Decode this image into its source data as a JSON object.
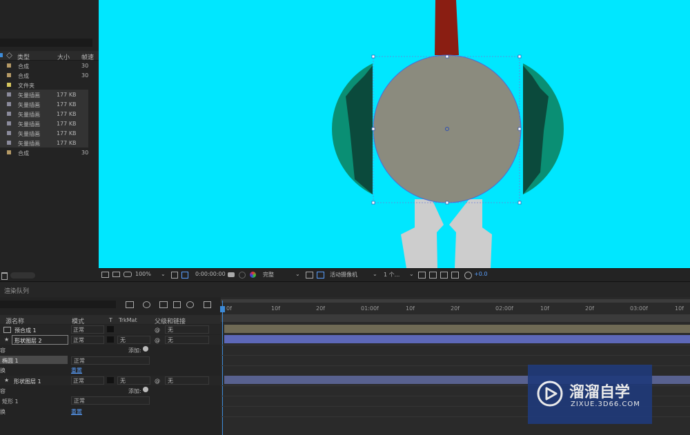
{
  "project_panel": {
    "columns": {
      "type": "类型",
      "size": "大小",
      "fps": "帧速"
    },
    "items": [
      {
        "type": "合成",
        "size": "",
        "fps": "30",
        "color": "#b59a66",
        "highlight": false
      },
      {
        "type": "合成",
        "size": "",
        "fps": "30",
        "color": "#b59a66",
        "highlight": false
      },
      {
        "type": "文件夹",
        "size": "",
        "fps": "",
        "color": "#d6c65e",
        "highlight": false
      },
      {
        "type": "矢量插画",
        "size": "177 KB",
        "fps": "",
        "color": "#8b8b9c",
        "highlight": true
      },
      {
        "type": "矢量插画",
        "size": "177 KB",
        "fps": "",
        "color": "#8b8b9c",
        "highlight": true
      },
      {
        "type": "矢量插画",
        "size": "177 KB",
        "fps": "",
        "color": "#8b8b9c",
        "highlight": true
      },
      {
        "type": "矢量插画",
        "size": "177 KB",
        "fps": "",
        "color": "#8b8b9c",
        "highlight": true
      },
      {
        "type": "矢量插画",
        "size": "177 KB",
        "fps": "",
        "color": "#8b8b9c",
        "highlight": true
      },
      {
        "type": "矢量插画",
        "size": "177 KB",
        "fps": "",
        "color": "#8b8b9c",
        "highlight": true
      },
      {
        "type": "合成",
        "size": "",
        "fps": "30",
        "color": "#b59a66",
        "highlight": false
      }
    ]
  },
  "viewer": {
    "background": "#00e7ff",
    "shape_colors": {
      "circle": "#8b8b7e",
      "teal": "#0a8f74",
      "dark": "#0b4a3c",
      "red": "#8a1e12",
      "legs": "#cdcdcd"
    },
    "toolbar": {
      "zoom": "100%",
      "timecode": "0:00:00:00",
      "resolution": "完整",
      "camera": "活动摄像机",
      "views": "1 个...",
      "exposure": "+0.0"
    }
  },
  "timeline": {
    "tab_label": "渲染队列",
    "headers": {
      "source_name": "源名称",
      "mode": "模式",
      "t": "T",
      "trkmat": "TrkMat",
      "parent": "父级和链接"
    },
    "layers": [
      {
        "name": "预合成 1",
        "mode": "正常",
        "trkmat": "",
        "parent": "无",
        "bar_color": "#6f6a55"
      },
      {
        "name": "形状图层 2",
        "mode": "正常",
        "trkmat": "无",
        "parent": "无",
        "bar_color": "#5d68b8"
      },
      {
        "name": "形状图层 1",
        "mode": "正常",
        "trkmat": "无",
        "parent": "无",
        "bar_color": "#58618f"
      }
    ],
    "sub_rows": {
      "add_label": "添加:",
      "path1": "椭圆 1",
      "rect1": "矩形 1",
      "normal": "正常",
      "reset": "重置",
      "content_short": "容",
      "transform_short": "换"
    },
    "ruler": [
      "0f",
      "10f",
      "20f",
      "01:00f",
      "10f",
      "20f",
      "02:00f",
      "10f",
      "20f",
      "03:00f",
      "10f"
    ]
  },
  "watermark": {
    "brand": "溜溜自学",
    "url": "ZIXUE.3D66.COM"
  }
}
